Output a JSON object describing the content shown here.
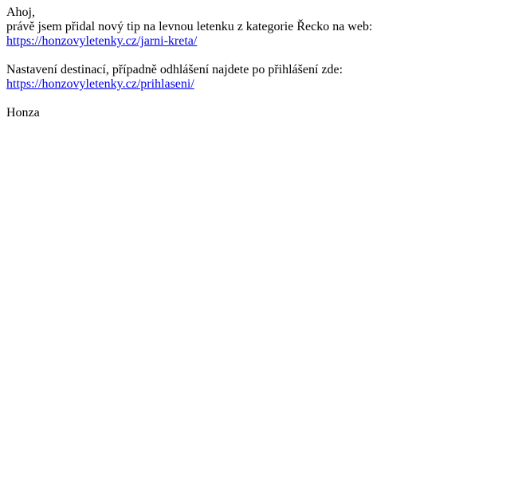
{
  "email": {
    "greeting": "Ahoj,",
    "intro_line": "právě jsem přidal nový tip na levnou letenku z kategorie Řecko na web:",
    "tip_link": "https://honzovyletenky.cz/jarni-kreta/",
    "settings_line": "Nastavení destinací, případně odhlášení najdete po přihlášení zde:",
    "login_link": "https://honzovyletenky.cz/prihlaseni/",
    "signature": "Honza"
  }
}
